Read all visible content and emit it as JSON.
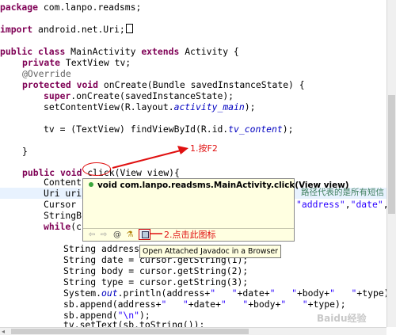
{
  "code": {
    "package_kw": "package",
    "package_name": " com.lanpo.readsms;",
    "import_kw": "import",
    "import_name": " android.net.Uri;",
    "class_kw1": "public",
    "class_kw2": "class",
    "class_name": " MainActivity ",
    "class_kw3": "extends",
    "class_rest": " Activity {",
    "field_kw": "private",
    "field_rest": " TextView tv;",
    "override": "@Override",
    "oncreate_kw1": "protected",
    "oncreate_kw2": "void",
    "oncreate_rest": " onCreate(Bundle savedInstanceState) {",
    "super_kw": "super",
    "super_rest": ".onCreate(savedInstanceState);",
    "setcontent_pre": "setContentView(R.layout.",
    "setcontent_field": "activity_main",
    "setcontent_post": ");",
    "tv_pre": "tv = (TextView) findViewById(R.id.",
    "tv_field": "tv_content",
    "tv_post": ");",
    "close_brace": "}",
    "click_kw1": "public",
    "click_kw2": "void",
    "click_name": " click",
    "click_rest": "(View view){",
    "l_content": "Content",
    "l_uri": "Uri uri",
    "l_cursor": "Cursor c",
    "l_stringb": "StringBu",
    "l_while_kw": "while",
    "l_while_rest": "(cu",
    "l_right1": "路径代表的是所有短信",
    "l_right2_str1": "\"address\"",
    "l_right2_mid": ",",
    "l_right2_str2": "\"date\"",
    "l_right2_end": ",",
    "l_addr": "String address",
    "l_date": "String date = cursor.getString(1);",
    "l_body": "String body = cursor.getString(2);",
    "l_type": "String type = cursor.getString(3);",
    "l_println_pre": "System.",
    "l_println_out": "out",
    "l_println_mid": ".println(address+",
    "l_println_s1": "\"   \"",
    "l_println_m2": "+date+",
    "l_println_s2": "\"   \"",
    "l_println_m3": "+body+",
    "l_println_s3": "\"   \"",
    "l_println_end": "+type);",
    "l_sb_pre": "sb.append(address+",
    "l_sb_s1": "\"   \"",
    "l_sb_m2": "+date+",
    "l_sb_s2": "\"   \"",
    "l_sb_m3": "+body+",
    "l_sb_s3": "\"   \"",
    "l_sb_end": "+type);",
    "l_sbn_pre": "sb.append(",
    "l_sbn_str": "\"\\n\"",
    "l_sbn_end": ");",
    "l_last": "tv.setText(sb.toString());"
  },
  "popup": {
    "signature": "void com.lanpo.readsms.MainActivity.click(View view)",
    "toolbar": {
      "back_icon": "⇦",
      "forward_icon": "⇨",
      "at_icon": "@",
      "source_icon": "⚗",
      "open_browser_icon": "browser-icon"
    },
    "tooltip": "Open Attached Javadoc in a Browser"
  },
  "annotations": {
    "step1": "1.按F2",
    "step2": "2.点击此图标",
    "color": "#e01010"
  },
  "watermark": "Baidu经验"
}
